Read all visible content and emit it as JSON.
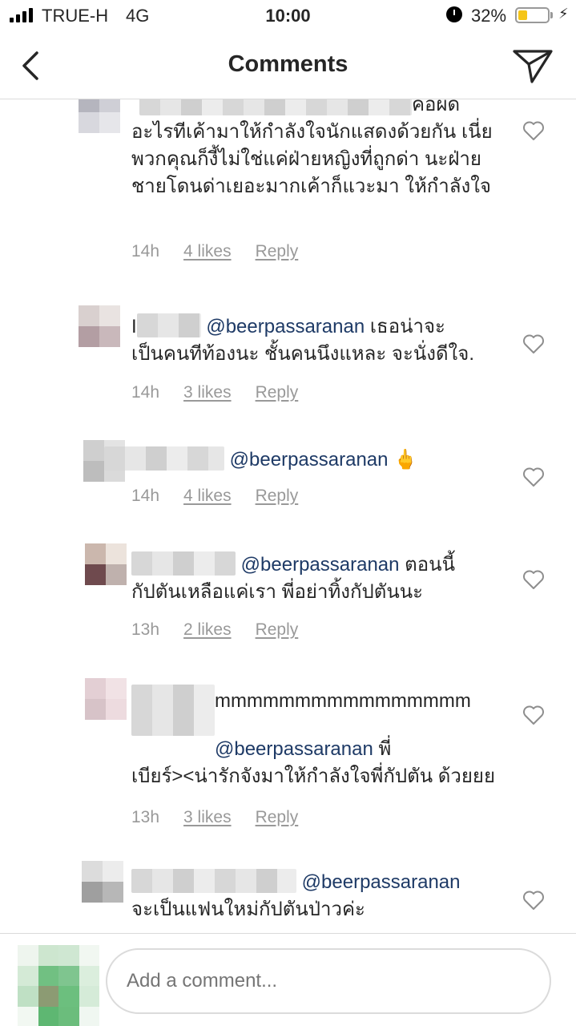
{
  "status_bar": {
    "carrier": "TRUE-H",
    "network": "4G",
    "time": "10:00",
    "battery_percent_label": "32%",
    "battery_level": 0.32,
    "battery_color": "#f5c518"
  },
  "nav": {
    "title": "Comments",
    "back_icon": "chevron-left-icon",
    "send_icon": "paper-plane-icon"
  },
  "comments": [
    {
      "lines_after_blur": "คือผิด",
      "text": "อะไรทีเค้ามาให้กำลังใจนักแสดงด้วยกัน เนี่ยพวกคุณก็งี้ไม่ใช่แค่ฝ่ายหญิงที่ถูกด่า นะฝ่ายชายโดนด่าเยอะมากเค้าก็แวะมา ให้กำลังใจ",
      "time": "14h",
      "likes": "4 likes",
      "reply": "Reply"
    },
    {
      "prefix": "I",
      "mention": "@beerpassaranan",
      "text_inline": " เธอน่าจะ",
      "text": "เป็นคนทีท้องนะ ชั้นคนนึงแหละ จะนั่งดีใจ.",
      "time": "14h",
      "likes": "3 likes",
      "reply": "Reply"
    },
    {
      "mention": "@beerpassaranan",
      "emoji": "🖕",
      "time": "14h",
      "likes": "4 likes",
      "reply": "Reply"
    },
    {
      "mention": "@beerpassaranan",
      "text_inline": " ตอนนี้",
      "text": "กัปตันเหลือแค่เรา พี่อย่าทิ้งกัปตันนะ",
      "time": "13h",
      "likes": "2 likes",
      "reply": "Reply"
    },
    {
      "text_inline": "mmmmmmmmmmmmmmmm",
      "mention": "@beerpassaranan",
      "text_after_mention": " พี่",
      "text": "เบียร์><น่ารักจังมาให้กำลังใจพี่กัปตัน ด้วยยย",
      "time": "13h",
      "likes": "3 likes",
      "reply": "Reply"
    },
    {
      "mention": "@beerpassaranan",
      "text": "จะเป็นแฟนใหม่กัปตันป่าวค่ะ"
    }
  ],
  "add_comment": {
    "placeholder": "Add a comment..."
  },
  "colors": {
    "mention": "#1e3a66",
    "meta": "#999999",
    "divider": "#dbdbdb"
  }
}
